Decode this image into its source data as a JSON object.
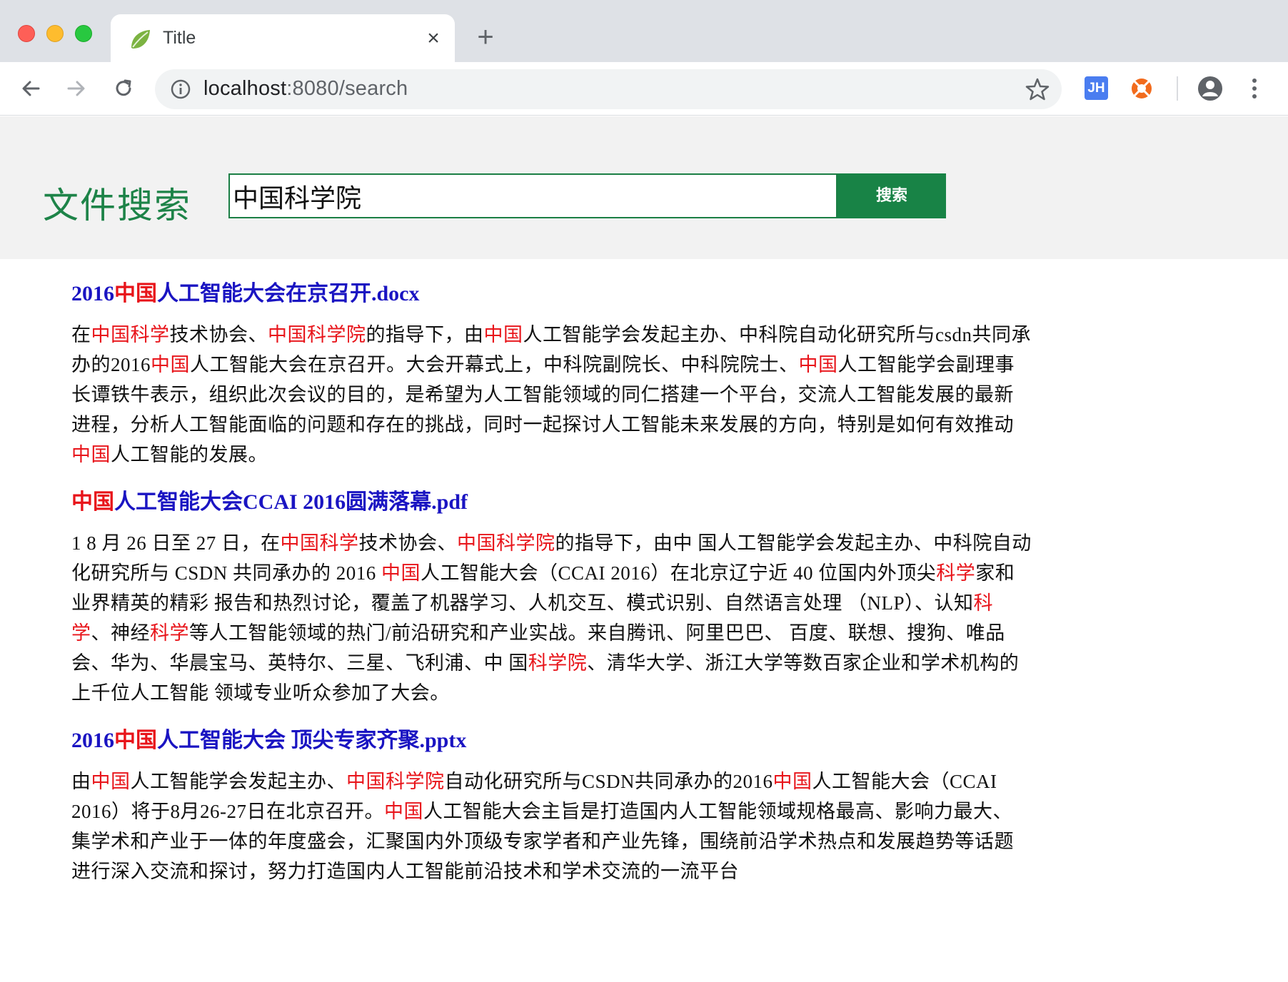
{
  "browser": {
    "tab_title": "Title",
    "tab_close": "×",
    "new_tab": "+",
    "url_host": "localhost",
    "url_path": ":8080/search",
    "extension_jh": "JH",
    "accent_color": "#1d8348"
  },
  "page": {
    "title": "文件搜索",
    "search_value": "中国科学院",
    "search_button": "搜索"
  },
  "highlight_color": "#e8141a",
  "link_color": "#1a14c2",
  "results": [
    {
      "title": [
        {
          "t": "2016",
          "h": false
        },
        {
          "t": "中国",
          "h": true
        },
        {
          "t": "人工智能大会在京召开.docx",
          "h": false
        }
      ],
      "body": [
        {
          "t": "在",
          "h": false
        },
        {
          "t": "中国科学",
          "h": true
        },
        {
          "t": "技术协会、",
          "h": false
        },
        {
          "t": "中国科学院",
          "h": true
        },
        {
          "t": "的指导下，由",
          "h": false
        },
        {
          "t": "中国",
          "h": true
        },
        {
          "t": "人工智能学会发起主办、中科院自动化研究所与csdn共同承办的2016",
          "h": false
        },
        {
          "t": "中国",
          "h": true
        },
        {
          "t": "人工智能大会在京召开。大会开幕式上，中科院副院长、中科院院士、",
          "h": false
        },
        {
          "t": "中国",
          "h": true
        },
        {
          "t": "人工智能学会副理事长谭铁牛表示，组织此次会议的目的，是希望为人工智能领域的同仁搭建一个平台，交流人工智能发展的最新进程，分析人工智能面临的问题和存在的挑战，同时一起探讨人工智能未来发展的方向，特别是如何有效推动",
          "h": false
        },
        {
          "t": "中国",
          "h": true
        },
        {
          "t": "人工智能的发展。",
          "h": false
        }
      ]
    },
    {
      "title": [
        {
          "t": "中国",
          "h": true
        },
        {
          "t": "人工智能大会CCAI 2016圆满落幕.pdf",
          "h": false
        }
      ],
      "body": [
        {
          "t": "1 8 月 26 日至 27 日，在",
          "h": false
        },
        {
          "t": "中国科学",
          "h": true
        },
        {
          "t": "技术协会、",
          "h": false
        },
        {
          "t": "中国科学院",
          "h": true
        },
        {
          "t": "的指导下，由中 国人工智能学会发起主办、中科院自动化研究所与 CSDN 共同承办的 2016 ",
          "h": false
        },
        {
          "t": "中国",
          "h": true
        },
        {
          "t": "人工智能大会（CCAI 2016）在北京辽宁近 40 位国内外顶尖",
          "h": false
        },
        {
          "t": "科学",
          "h": true
        },
        {
          "t": "家和业界精英的精彩 报告和热烈讨论，覆盖了机器学习、人机交互、模式识别、自然语言处理 （NLP）、认知",
          "h": false
        },
        {
          "t": "科学",
          "h": true
        },
        {
          "t": "、神经",
          "h": false
        },
        {
          "t": "科学",
          "h": true
        },
        {
          "t": "等人工智能领域的热门/前沿研究和产业实战。来自腾讯、阿里巴巴、 百度、联想、搜狗、唯品会、华为、华晨宝马、英特尔、三星、飞利浦、中 国",
          "h": false
        },
        {
          "t": "科学院",
          "h": true
        },
        {
          "t": "、清华大学、浙江大学等数百家企业和学术机构的上千位人工智能 领域专业听众参加了大会。",
          "h": false
        }
      ]
    },
    {
      "title": [
        {
          "t": "2016",
          "h": false
        },
        {
          "t": "中国",
          "h": true
        },
        {
          "t": "人工智能大会 顶尖专家齐聚.pptx",
          "h": false
        }
      ],
      "body": [
        {
          "t": "由",
          "h": false
        },
        {
          "t": "中国",
          "h": true
        },
        {
          "t": "人工智能学会发起主办、",
          "h": false
        },
        {
          "t": "中国科学院",
          "h": true
        },
        {
          "t": "自动化研究所与CSDN共同承办的2016",
          "h": false
        },
        {
          "t": "中国",
          "h": true
        },
        {
          "t": "人工智能大会（CCAI 2016）将于8月26-27日在北京召开。",
          "h": false
        },
        {
          "t": "中国",
          "h": true
        },
        {
          "t": "人工智能大会主旨是打造国内人工智能领域规格最高、影响力最大、集学术和产业于一体的年度盛会，汇聚国内外顶级专家学者和产业先锋，围绕前沿学术热点和发展趋势等话题进行深入交流和探讨，努力打造国内人工智能前沿技术和学术交流的一流平台",
          "h": false
        }
      ]
    }
  ]
}
